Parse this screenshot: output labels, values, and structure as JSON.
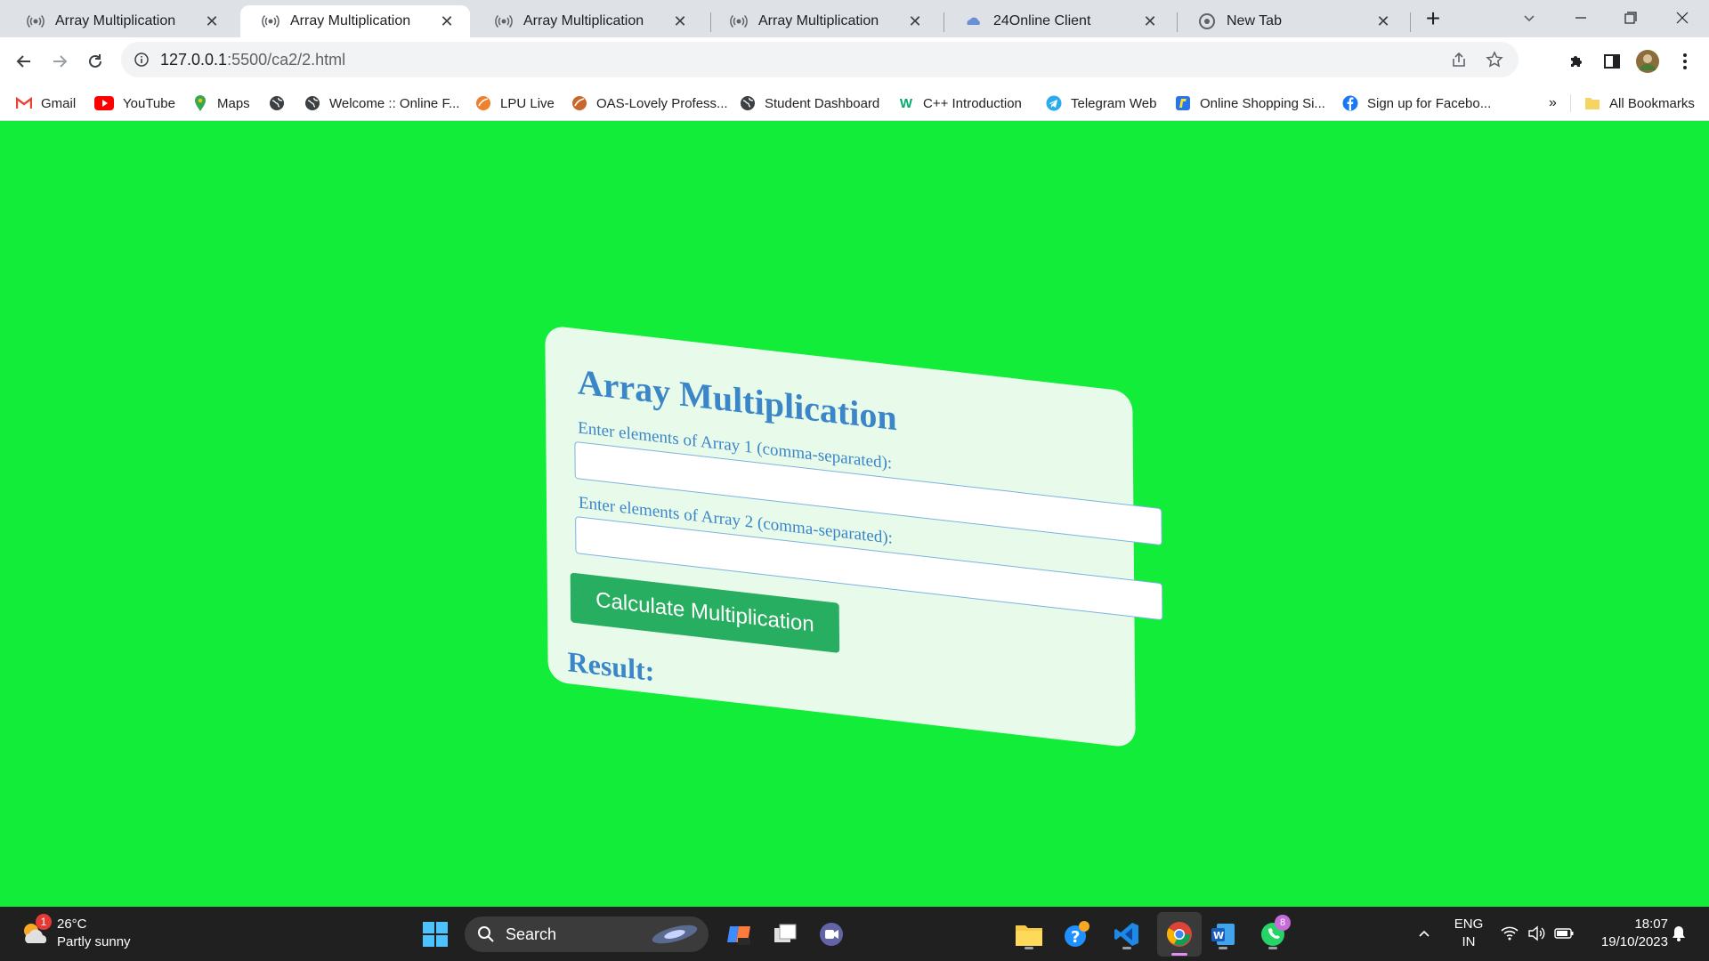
{
  "browser": {
    "tabs": [
      {
        "title": "Array Multiplication",
        "active": false
      },
      {
        "title": "Array Multiplication",
        "active": true
      },
      {
        "title": "Array Multiplication",
        "active": false
      },
      {
        "title": "Array Multiplication",
        "active": false
      },
      {
        "title": "24Online Client",
        "active": false
      },
      {
        "title": "New Tab",
        "active": false
      }
    ],
    "url_host": "127.0.0.1",
    "url_path": ":5500/ca2/2.html",
    "bookmarks": [
      {
        "label": "Gmail",
        "icon": "gmail-icon"
      },
      {
        "label": "YouTube",
        "icon": "youtube-icon"
      },
      {
        "label": "Maps",
        "icon": "maps-icon"
      },
      {
        "label": "",
        "icon": "globe-icon"
      },
      {
        "label": "Welcome :: Online F...",
        "icon": "globe-icon"
      },
      {
        "label": "LPU Live",
        "icon": "lpu-icon"
      },
      {
        "label": "OAS-Lovely Profess...",
        "icon": "lpu-icon"
      },
      {
        "label": "Student Dashboard",
        "icon": "globe-icon"
      },
      {
        "label": "C++ Introduction",
        "icon": "w3schools-icon"
      },
      {
        "label": "Telegram Web",
        "icon": "telegram-icon"
      },
      {
        "label": "Online Shopping Si...",
        "icon": "flipkart-icon"
      },
      {
        "label": "Sign up for Facebo...",
        "icon": "facebook-icon"
      }
    ],
    "more_bookmarks": "»",
    "all_bookmarks": "All Bookmarks"
  },
  "page": {
    "heading": "Array Multiplication",
    "array1_label": "Enter elements of Array 1 (comma-separated):",
    "array1_value": "",
    "array2_label": "Enter elements of Array 2 (comma-separated):",
    "array2_value": "",
    "button_label": "Calculate Multiplication",
    "result_label": "Result:"
  },
  "taskbar": {
    "weather_temp": "26°C",
    "weather_desc": "Partly sunny",
    "weather_badge": "1",
    "search_label": "Search",
    "whatsapp_badge": "8",
    "lang_line1": "ENG",
    "lang_line2": "IN",
    "time": "18:07",
    "date": "19/10/2023"
  },
  "colors": {
    "page_bg": "#12ed3a",
    "card_bg": "#e8fbea",
    "heading": "#3a86c8",
    "button": "#27ae60"
  }
}
